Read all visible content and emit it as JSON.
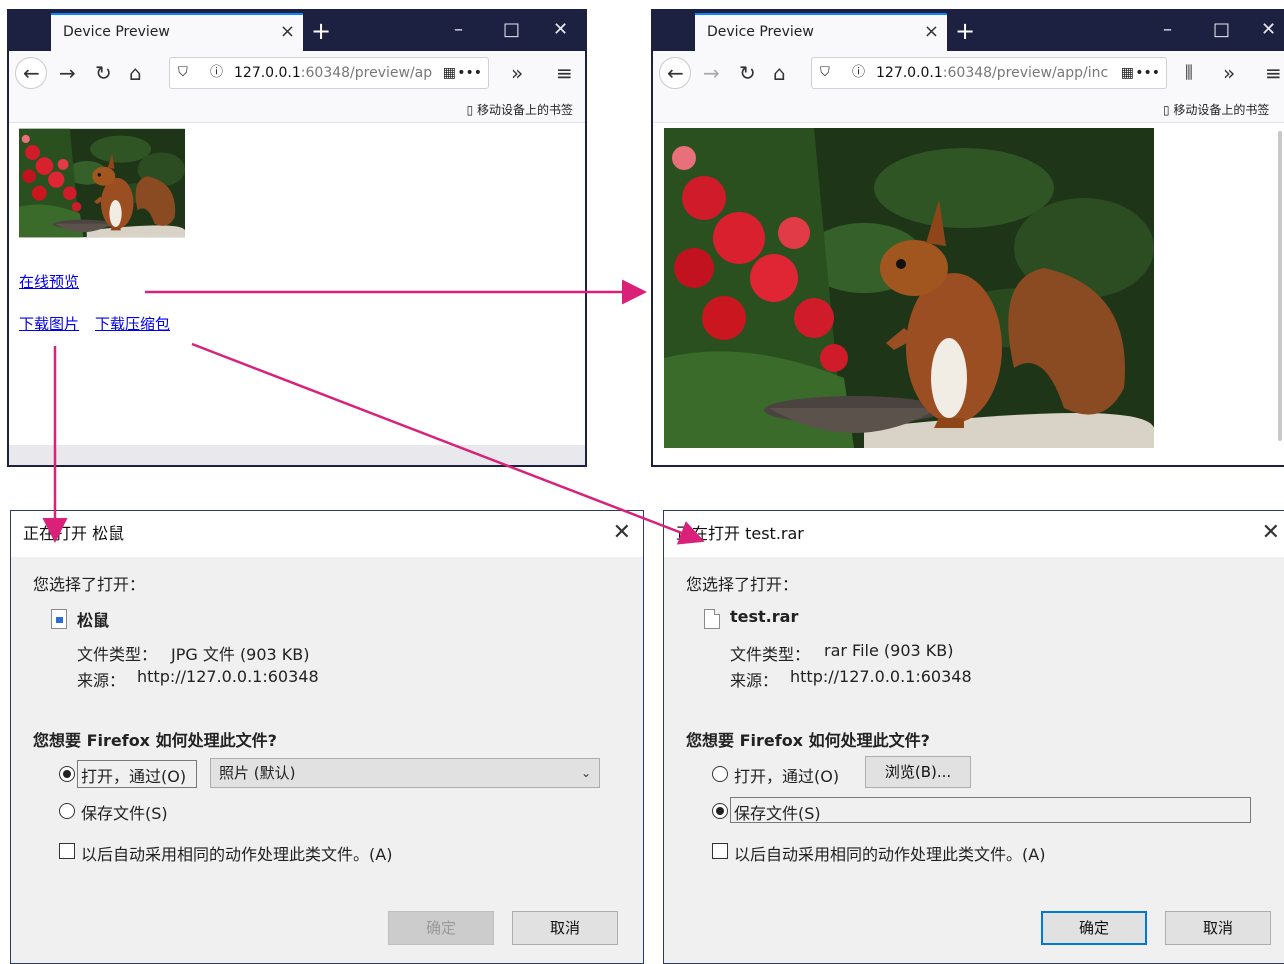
{
  "colors": {
    "tab_bar": "#1c2142",
    "link": "#0000ee",
    "arrow": "#d9217a",
    "dialog_bg": "#f0f0f0",
    "accent_focus": "#0078d7"
  },
  "browser_left": {
    "tab_title": "Device Preview",
    "url_host": "127.0.0.1",
    "url_rest": ":60348/preview/ap",
    "bookmark_label": "移动设备上的书签",
    "links": {
      "preview": "在线预览",
      "download_image": "下载图片",
      "download_zip": "下载压缩包"
    },
    "icons": [
      "back-icon",
      "forward-icon",
      "reload-icon",
      "home-icon",
      "shield-icon",
      "info-icon",
      "qr-icon",
      "more-icon",
      "overflow-icon",
      "menu-icon"
    ]
  },
  "browser_right": {
    "tab_title": "Device Preview",
    "url_host": "127.0.0.1",
    "url_rest": ":60348/preview/app/inc",
    "bookmark_label": "移动设备上的书签",
    "icons": [
      "back-icon",
      "forward-icon",
      "reload-icon",
      "home-icon",
      "shield-icon",
      "info-icon",
      "qr-icon",
      "more-icon",
      "library-icon",
      "overflow-icon",
      "menu-icon"
    ]
  },
  "dialog_left": {
    "title": "正在打开 松鼠",
    "chose_label": "您选择了打开：",
    "file_name": "松鼠",
    "type_label": "文件类型：",
    "type_value": "JPG 文件 (903 KB)",
    "source_label": "来源：",
    "source_value": "http://127.0.0.1:60348",
    "question": "您想要 Firefox 如何处理此文件?",
    "open_with_label": "打开，通过(O)",
    "open_with_app": "照片 (默认)",
    "save_label": "保存文件(S)",
    "auto_label": "以后自动采用相同的动作处理此类文件。(A)",
    "ok_label": "确定",
    "cancel_label": "取消",
    "selected_option": "open"
  },
  "dialog_right": {
    "title": "正在打开 test.rar",
    "chose_label": "您选择了打开：",
    "file_name": "test.rar",
    "type_label": "文件类型：",
    "type_value": "rar File (903 KB)",
    "source_label": "来源：",
    "source_value": "http://127.0.0.1:60348",
    "question": "您想要 Firefox 如何处理此文件?",
    "open_with_label": "打开，通过(O)",
    "browse_label": "浏览(B)...",
    "save_label": "保存文件(S)",
    "auto_label": "以后自动采用相同的动作处理此类文件。(A)",
    "ok_label": "确定",
    "cancel_label": "取消",
    "selected_option": "save"
  }
}
